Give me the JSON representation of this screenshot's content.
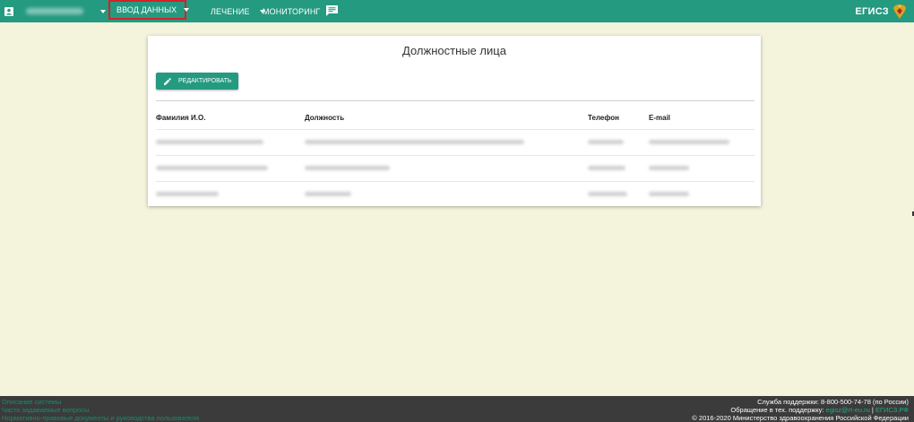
{
  "colors": {
    "accent": "#249a80",
    "background": "#f4f3dc",
    "footer": "#3b3b3b",
    "highlight": "#d8202a"
  },
  "topbar": {
    "user_icon": "account-box-icon",
    "menu": {
      "data_entry": "Ввод данных",
      "treatment": "Лечение",
      "monitoring": "Мониторинг"
    },
    "chat_icon": "chat-icon",
    "brand": "ЕГИСЗ",
    "emblem_icon": "coat-of-arms-icon"
  },
  "card": {
    "title": "Должностные лица",
    "edit_button": "Редактировать",
    "edit_icon": "pencil-icon",
    "columns": {
      "name": "Фамилия И.О.",
      "position": "Должность",
      "phone": "Телефон",
      "email": "E-mail"
    }
  },
  "footer": {
    "links": {
      "system_description": "Описание системы",
      "faq": "Часто задаваемые вопросы",
      "docs": "Нормативно-правовые документы и руководства пользователя"
    },
    "support_line": "Служба поддержки: 8-800-500-74-78 (по России)",
    "contact_prefix": "Обращение в тех. поддержку: ",
    "contact_email": "egisz@rt-eu.ru",
    "contact_sep": " | ",
    "contact_site": "ЕГИСЗ.РФ",
    "copyright": "© 2016-2020 Министерство здравоохранения Российской Федерации"
  }
}
